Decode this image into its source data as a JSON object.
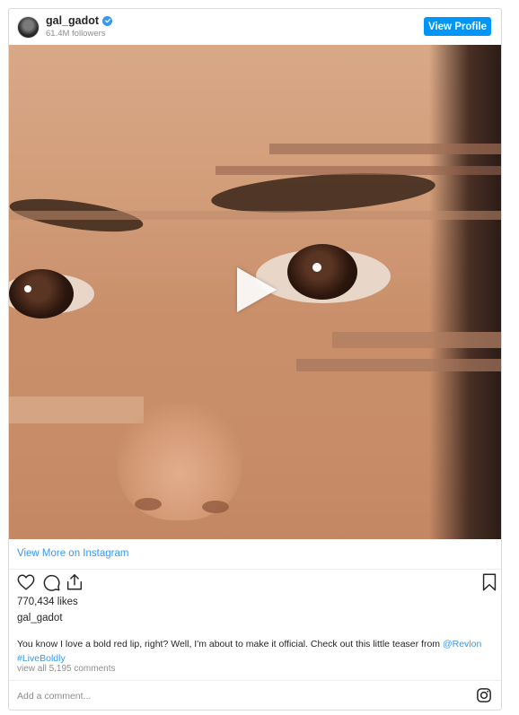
{
  "header": {
    "username": "gal_gadot",
    "followers": "61.4M followers",
    "view_profile_label": "View Profile"
  },
  "media": {
    "type": "video",
    "play_icon": "play-icon"
  },
  "view_more_label": "View More on Instagram",
  "actions": {
    "icons": [
      "heart-icon",
      "comment-icon",
      "share-icon",
      "bookmark-icon"
    ]
  },
  "likes": "770,434 likes",
  "author": "gal_gadot",
  "caption": {
    "text": "You know I love a bold red lip, right? Well, I'm about to make it official. Check out this little teaser from ",
    "mention": "@Revlon",
    "hashtag": "#LiveBoldly"
  },
  "comments_link": "view all 5,195 comments",
  "comment_bar": {
    "placeholder": "Add a comment...",
    "icon": "instagram-icon"
  },
  "colors": {
    "accent": "#3897f0",
    "button": "#0095f6",
    "muted": "#8e8e8e",
    "text": "#262626"
  }
}
